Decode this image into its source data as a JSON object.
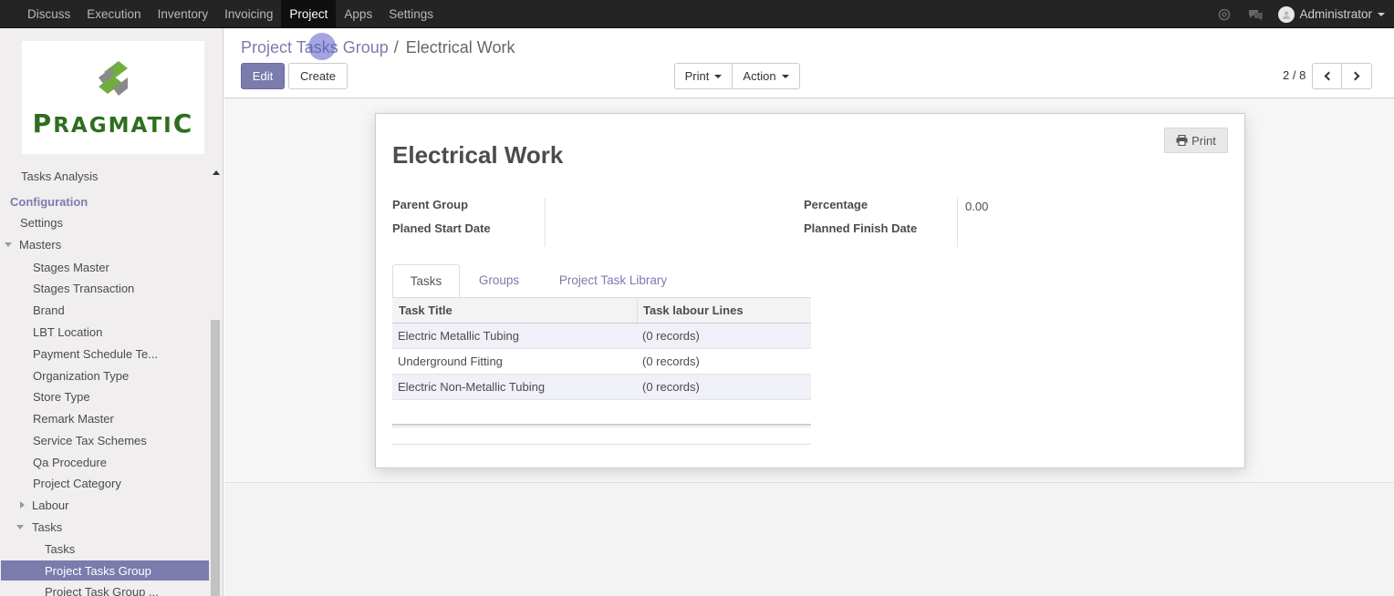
{
  "topbar": {
    "menu": [
      "Discuss",
      "Execution",
      "Inventory",
      "Invoicing",
      "Project",
      "Apps",
      "Settings"
    ],
    "active_index": 4,
    "user": "Administrator"
  },
  "sidebar": {
    "logo_text": "PRAGMATIC",
    "tasks_analysis": "Tasks Analysis",
    "configuration": "Configuration",
    "settings": "Settings",
    "masters": "Masters",
    "master_items": [
      "Stages Master",
      "Stages Transaction",
      "Brand",
      "LBT Location",
      "Payment Schedule Te...",
      "Organization Type",
      "Store Type",
      "Remark Master",
      "Service Tax Schemes",
      "Qa Procedure",
      "Project Category"
    ],
    "labour": "Labour",
    "tasks": "Tasks",
    "tasks_child": "Tasks",
    "project_tasks_group": "Project Tasks Group",
    "project_task_group_more": "Project Task Group ..."
  },
  "control": {
    "breadcrumb_parent": "Project Tasks Group",
    "breadcrumb_current": "Electrical Work",
    "edit": "Edit",
    "create": "Create",
    "print": "Print",
    "action": "Action",
    "pager": "2 / 8"
  },
  "record": {
    "print_btn": "Print",
    "title": "Electrical Work",
    "labels": {
      "parent_group": "Parent Group",
      "planed_start_date": "Planed Start Date",
      "percentage": "Percentage",
      "planned_finish_date": "Planned Finish Date"
    },
    "values": {
      "parent_group": "",
      "planed_start_date": "",
      "percentage": "0.00",
      "planned_finish_date": ""
    },
    "tabs": [
      "Tasks",
      "Groups",
      "Project Task Library"
    ],
    "table": {
      "headers": [
        "Task Title",
        "Task labour Lines"
      ],
      "rows": [
        [
          "Electric Metallic Tubing",
          "(0 records)"
        ],
        [
          "Underground Fitting",
          "(0 records)"
        ],
        [
          "Electric Non-Metallic Tubing",
          "(0 records)"
        ]
      ]
    }
  }
}
